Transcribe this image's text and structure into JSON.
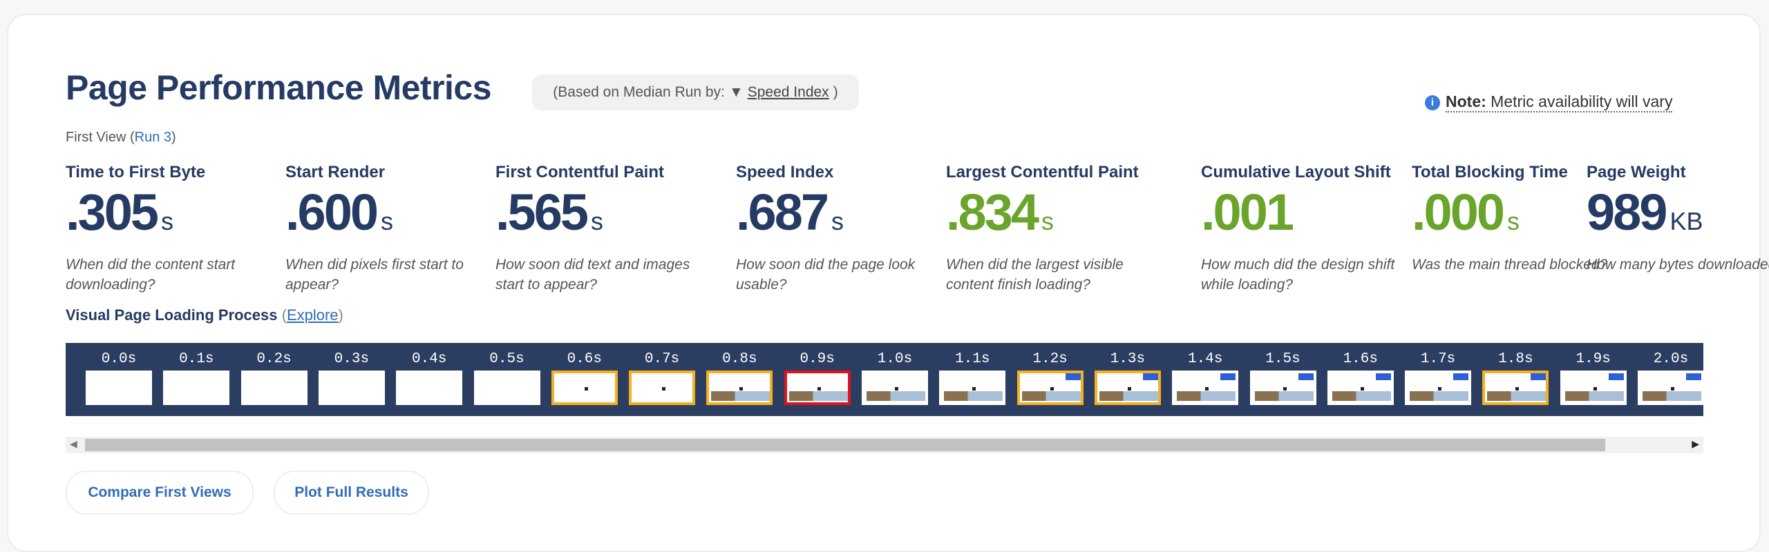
{
  "header": {
    "title": "Page Performance Metrics",
    "median_prefix": "(Based on Median Run by:",
    "median_arrow": "▼",
    "median_metric": "Speed Index",
    "median_suffix": ")",
    "note_label": "Note:",
    "note_text": "Metric availability will vary"
  },
  "view": {
    "label": "First View (",
    "run": "Run 3",
    "close": ")"
  },
  "metrics": [
    {
      "label": "Time to First Byte",
      "value": ".305",
      "unit": "s",
      "desc": "When did the content start downloading?",
      "status": "neutral"
    },
    {
      "label": "Start Render",
      "value": ".600",
      "unit": "s",
      "desc": "When did pixels first start to appear?",
      "status": "neutral"
    },
    {
      "label": "First Contentful Paint",
      "value": ".565",
      "unit": "s",
      "desc": "How soon did text and images start to appear?",
      "status": "neutral"
    },
    {
      "label": "Speed Index",
      "value": ".687",
      "unit": "s",
      "desc": "How soon did the page look usable?",
      "status": "neutral"
    },
    {
      "label": "Largest Contentful Paint",
      "value": ".834",
      "unit": "s",
      "desc": "When did the largest visible content finish loading?",
      "status": "good"
    },
    {
      "label": "Cumulative Layout Shift",
      "value": ".001",
      "unit": "",
      "desc": "How much did the design shift while loading?",
      "status": "good"
    },
    {
      "label": "Total Blocking Time",
      "value": ".000",
      "unit": "s",
      "desc": "Was the main thread blocked?",
      "status": "good"
    },
    {
      "label": "Page Weight",
      "value": "989",
      "unit": "KB",
      "desc": "How many bytes downloaded?",
      "status": "neutral"
    }
  ],
  "filmstrip": {
    "title": "Visual Page Loading Process",
    "open": "(",
    "explore": "Explore",
    "close": ")",
    "colors": {
      "background": "#2c3d62",
      "changed": "#f5b021",
      "lcp": "#e3131c"
    },
    "frames": [
      {
        "time": "0.0s",
        "state": "blank"
      },
      {
        "time": "0.1s",
        "state": "blank"
      },
      {
        "time": "0.2s",
        "state": "blank"
      },
      {
        "time": "0.3s",
        "state": "blank"
      },
      {
        "time": "0.4s",
        "state": "blank"
      },
      {
        "time": "0.5s",
        "state": "blank"
      },
      {
        "time": "0.6s",
        "state": "changed"
      },
      {
        "time": "0.7s",
        "state": "changed"
      },
      {
        "time": "0.8s",
        "state": "changed"
      },
      {
        "time": "0.9s",
        "state": "lcp"
      },
      {
        "time": "1.0s",
        "state": "same"
      },
      {
        "time": "1.1s",
        "state": "same"
      },
      {
        "time": "1.2s",
        "state": "changed"
      },
      {
        "time": "1.3s",
        "state": "changed"
      },
      {
        "time": "1.4s",
        "state": "same"
      },
      {
        "time": "1.5s",
        "state": "same"
      },
      {
        "time": "1.6s",
        "state": "same"
      },
      {
        "time": "1.7s",
        "state": "same"
      },
      {
        "time": "1.8s",
        "state": "changed"
      },
      {
        "time": "1.9s",
        "state": "same"
      },
      {
        "time": "2.0s",
        "state": "same"
      }
    ]
  },
  "buttons": {
    "compare": "Compare First Views",
    "plot": "Plot Full Results"
  }
}
